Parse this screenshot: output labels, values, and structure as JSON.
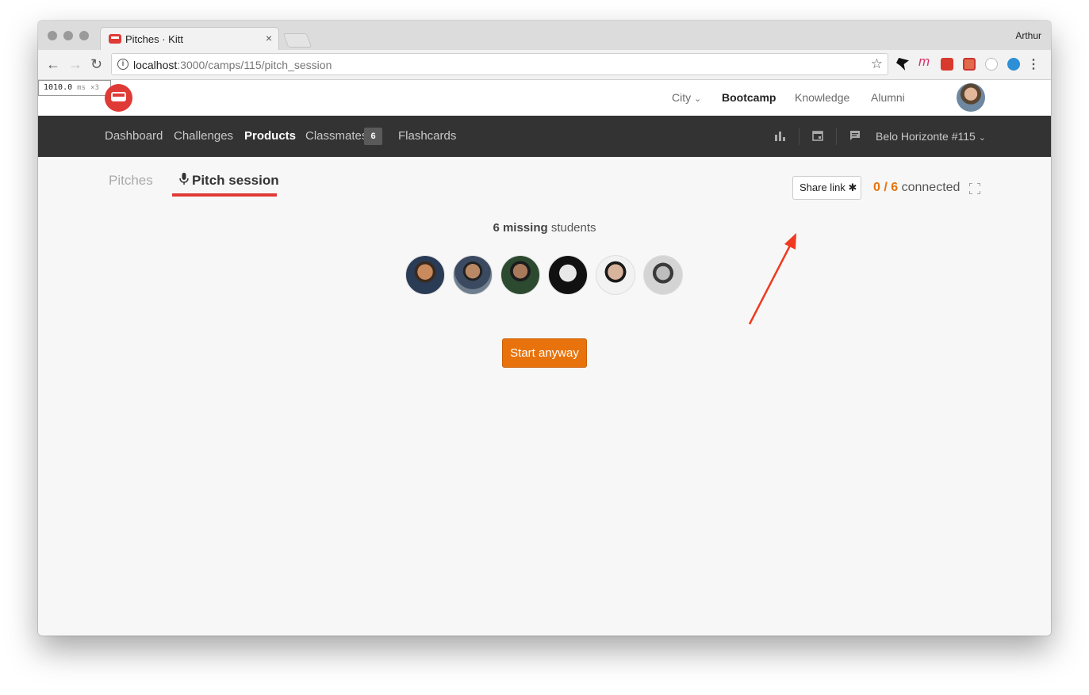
{
  "browser": {
    "tab_title": "Pitches · Kitt",
    "tab_close": "×",
    "profile_name": "Arthur",
    "url_host": "localhost",
    "url_rest": ":3000/camps/115/pitch_session",
    "info_glyph": "i",
    "star_glyph": "☆",
    "menu_glyph": "⋮"
  },
  "perf_overlay": {
    "value": "1010.0",
    "unit": "ms",
    "multiplier": "×3"
  },
  "top_nav": {
    "items": [
      {
        "label": "City",
        "active": false,
        "dropdown": true
      },
      {
        "label": "Bootcamp",
        "active": true
      },
      {
        "label": "Knowledge",
        "active": false
      },
      {
        "label": "Alumni",
        "active": false
      }
    ]
  },
  "main_nav": {
    "items": [
      {
        "label": "Dashboard",
        "active": false
      },
      {
        "label": "Challenges",
        "active": false
      },
      {
        "label": "Products",
        "active": true
      },
      {
        "label": "Classmates",
        "active": false,
        "badge": "6"
      },
      {
        "label": "Flashcards",
        "active": false
      }
    ],
    "camp_selector": "Belo Horizonte #115"
  },
  "subtabs": [
    {
      "label": "Pitches",
      "active": false
    },
    {
      "label": "Pitch session",
      "active": true
    }
  ],
  "share": {
    "label": "Share link"
  },
  "connection": {
    "count": "0 / 6",
    "label": "connected"
  },
  "missing": {
    "count_label": "6 missing",
    "suffix": "students"
  },
  "start_button": {
    "label": "Start anyway"
  },
  "colors": {
    "brand_red": "#e03a36",
    "orange": "#e8730c",
    "dark_nav": "#333333"
  }
}
